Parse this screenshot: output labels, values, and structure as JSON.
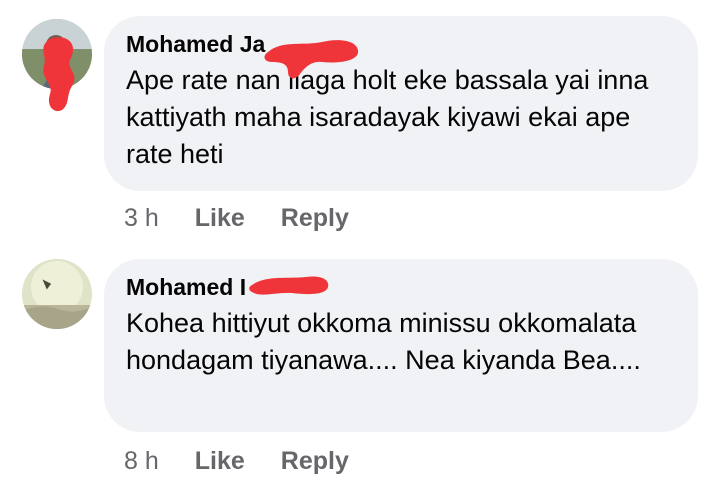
{
  "comments": [
    {
      "author": "Mohamed Ja",
      "text": "Ape rate nan ilaga holt eke bassala yai inna kattiyath maha isaradayak kiyawi ekai ape rate heti",
      "time": "3 h",
      "like_label": "Like",
      "reply_label": "Reply"
    },
    {
      "author": "Mohamed I",
      "text": "Kohea hittiyut okkoma minissu okkomalata hondagam tiyanawa.... Nea kiyanda Bea....",
      "time": "8 h",
      "like_label": "Like",
      "reply_label": "Reply"
    }
  ],
  "colors": {
    "bubble": "#f0f2f5",
    "text": "#050505",
    "meta": "#65676b",
    "redaction": "#f0353a"
  }
}
